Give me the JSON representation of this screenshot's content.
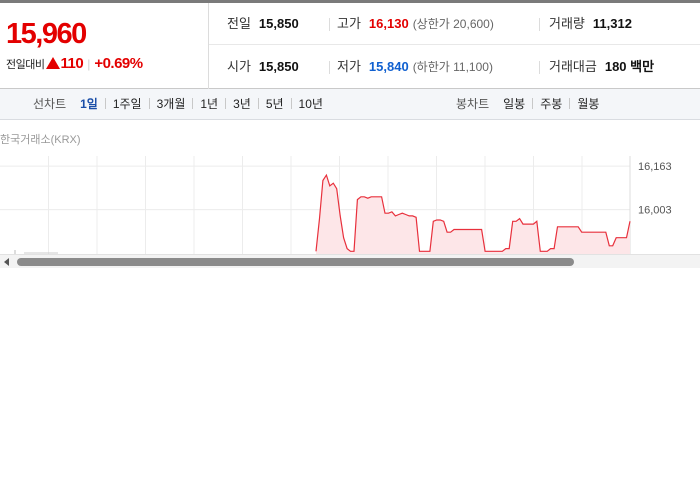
{
  "quote": {
    "current_price": "15,960",
    "change_label": "전일대비",
    "change_direction_icon": "up-triangle-icon",
    "change_abs": "110",
    "change_rate": "+0.69%",
    "accent_color": "#e30000"
  },
  "info": {
    "row1": {
      "prev_close": {
        "label": "전일",
        "value": "15,850"
      },
      "high": {
        "label": "고가",
        "value": "16,130",
        "sub": "(상한가 20,600)"
      },
      "volume": {
        "label": "거래량",
        "value": "11,312"
      }
    },
    "row2": {
      "open": {
        "label": "시가",
        "value": "15,850"
      },
      "low": {
        "label": "저가",
        "value": "15,840",
        "sub": "(하한가 11,100)"
      },
      "amount": {
        "label": "거래대금",
        "value": "180 백만"
      }
    }
  },
  "tabs": {
    "line_chart_title": "선차트",
    "line_chart_tabs": [
      "1일",
      "1주일",
      "3개월",
      "1년",
      "3년",
      "5년",
      "10년"
    ],
    "active_tab": "1일",
    "candle_chart_title": "봉차트",
    "candle_chart_tabs": [
      "일봉",
      "주봉",
      "월봉"
    ]
  },
  "chart": {
    "source": "한국거래소(KRX)",
    "line_color": "#e8303c",
    "fill_color": "#fde6e8"
  },
  "chart_data": {
    "type": "area",
    "title": "",
    "xlabel": "",
    "ylabel": "",
    "y_ticks": [
      "16,163",
      "16,003"
    ],
    "y_tick_values": [
      16163,
      16003
    ],
    "ylim": [
      15840,
      16200
    ],
    "grid": true,
    "x": [
      0,
      1,
      2,
      3,
      4,
      5,
      6,
      7,
      8,
      9,
      10,
      11,
      12,
      13,
      14,
      15,
      16,
      17,
      18,
      19,
      20,
      21,
      22,
      23,
      24,
      25,
      26,
      27,
      28,
      29,
      30,
      31,
      32,
      33,
      34,
      35,
      36,
      37,
      38,
      39,
      40,
      41,
      42,
      43,
      44,
      45,
      46,
      47,
      48,
      49,
      50,
      51,
      52,
      53,
      54,
      55,
      56,
      57,
      58,
      59,
      60,
      61,
      62,
      63,
      64,
      65,
      66,
      67,
      68,
      69,
      70,
      71,
      72,
      73,
      74,
      75,
      76,
      77,
      78,
      79,
      80,
      81,
      82,
      83,
      84,
      85,
      86,
      87,
      88,
      89,
      90,
      91
    ],
    "values": [
      15850,
      15970,
      16110,
      16130,
      16090,
      16100,
      16080,
      15980,
      15900,
      15860,
      15850,
      15850,
      16040,
      16050,
      16050,
      16045,
      16050,
      16050,
      16050,
      16050,
      15990,
      15990,
      15995,
      15980,
      15985,
      15990,
      15985,
      15980,
      15980,
      15975,
      15850,
      15850,
      15850,
      15850,
      15960,
      15965,
      15965,
      15960,
      15920,
      15920,
      15930,
      15930,
      15930,
      15930,
      15930,
      15930,
      15930,
      15930,
      15930,
      15850,
      15850,
      15850,
      15850,
      15850,
      15850,
      15860,
      15860,
      15960,
      15960,
      15970,
      15950,
      15950,
      15950,
      15950,
      15960,
      15850,
      15850,
      15850,
      15860,
      15860,
      15940,
      15940,
      15940,
      15940,
      15940,
      15940,
      15940,
      15920,
      15920,
      15920,
      15920,
      15920,
      15920,
      15920,
      15920,
      15870,
      15870,
      15900,
      15900,
      15900,
      15900,
      15960
    ]
  },
  "scrollbar": {
    "left_arrow_icon": "scroll-left-arrow-icon",
    "thumb_fraction": 0.8
  }
}
